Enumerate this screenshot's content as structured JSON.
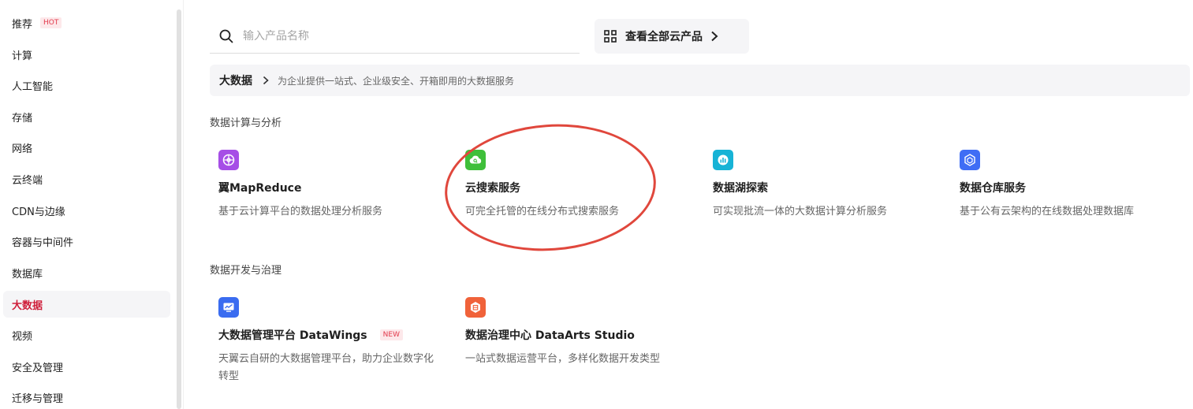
{
  "sidebar": {
    "items": [
      {
        "label": "推荐",
        "badge": "HOT"
      },
      {
        "label": "计算"
      },
      {
        "label": "人工智能"
      },
      {
        "label": "存储"
      },
      {
        "label": "网络"
      },
      {
        "label": "云终端"
      },
      {
        "label": "CDN与边缘"
      },
      {
        "label": "容器与中间件"
      },
      {
        "label": "数据库"
      },
      {
        "label": "大数据",
        "active": true
      },
      {
        "label": "视频"
      },
      {
        "label": "安全及管理"
      },
      {
        "label": "迁移与管理"
      }
    ]
  },
  "search": {
    "placeholder": "输入产品名称",
    "value": ""
  },
  "all_products": {
    "label": "查看全部云产品"
  },
  "category": {
    "name": "大数据",
    "desc": "为企业提供一站式、企业级安全、开箱即用的大数据服务"
  },
  "sections": [
    {
      "title": "数据计算与分析",
      "products": [
        {
          "name": "翼MapReduce",
          "desc": "基于云计算平台的数据处理分析服务",
          "icon": "mapreduce-icon",
          "color": "#a64ee6"
        },
        {
          "name": "云搜索服务",
          "desc": "可完全托管的在线分布式搜索服务",
          "icon": "cloud-search-icon",
          "color": "#3fbf3a"
        },
        {
          "name": "数据湖探索",
          "desc": "可实现批流一体的大数据计算分析服务",
          "icon": "data-lake-icon",
          "color": "#17b3d6"
        },
        {
          "name": "数据仓库服务",
          "desc": "基于公有云架构的在线数据处理数据库",
          "icon": "data-warehouse-icon",
          "color": "#3f6df5"
        }
      ]
    },
    {
      "title": "数据开发与治理",
      "products": [
        {
          "name": "大数据管理平台 DataWings",
          "badge": "NEW",
          "desc": "天翼云自研的大数据管理平台，助力企业数字化转型",
          "icon": "datawings-icon",
          "color": "#3a6cf0"
        },
        {
          "name": "数据治理中心 DataArts Studio",
          "desc": "一站式数据运营平台，多样化数据开发类型",
          "icon": "dataarts-icon",
          "color": "#f0623a"
        }
      ]
    }
  ]
}
